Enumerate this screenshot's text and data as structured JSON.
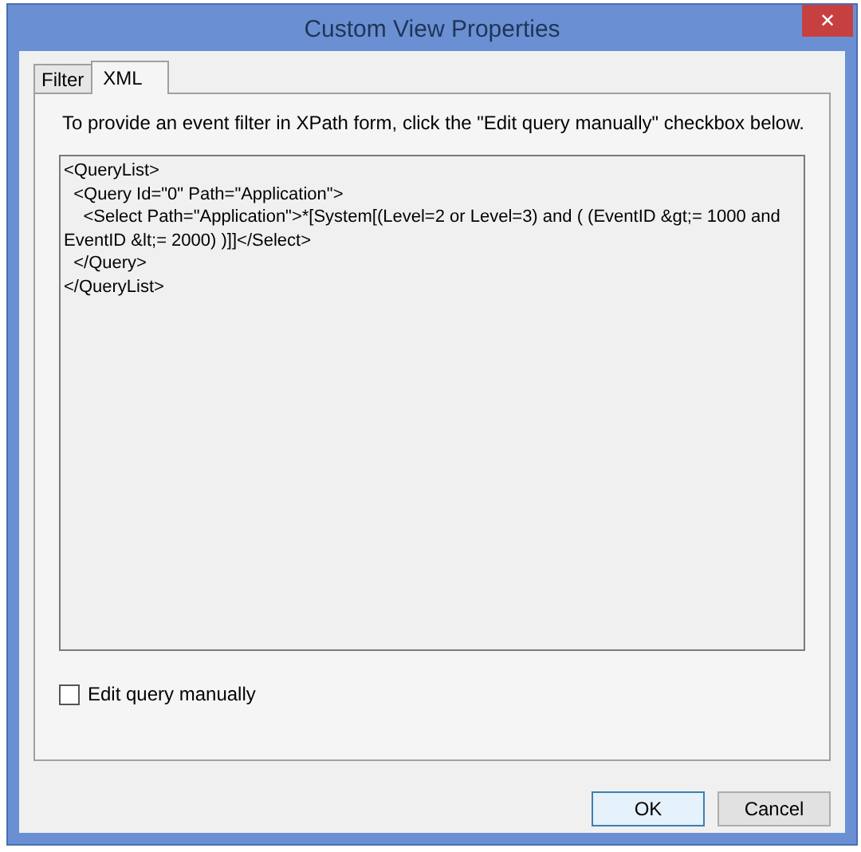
{
  "window": {
    "title": "Custom View Properties",
    "close": "✕"
  },
  "tabs": [
    {
      "label": "Filter",
      "selected": false
    },
    {
      "label": "XML",
      "selected": true
    }
  ],
  "instruction": "To provide an event filter in XPath form, click the \"Edit query manually\" checkbox below.",
  "query_xml": "<QueryList>\n  <Query Id=\"0\" Path=\"Application\">\n    <Select Path=\"Application\">*[System[(Level=2 or Level=3) and ( (EventID &gt;= 1000 and EventID &lt;= 2000) )]]</Select>\n  </Query>\n</QueryList>",
  "edit_manually": {
    "label": "Edit query manually",
    "checked": false
  },
  "buttons": [
    {
      "label": "OK",
      "default": true
    },
    {
      "label": "Cancel",
      "default": false
    }
  ]
}
